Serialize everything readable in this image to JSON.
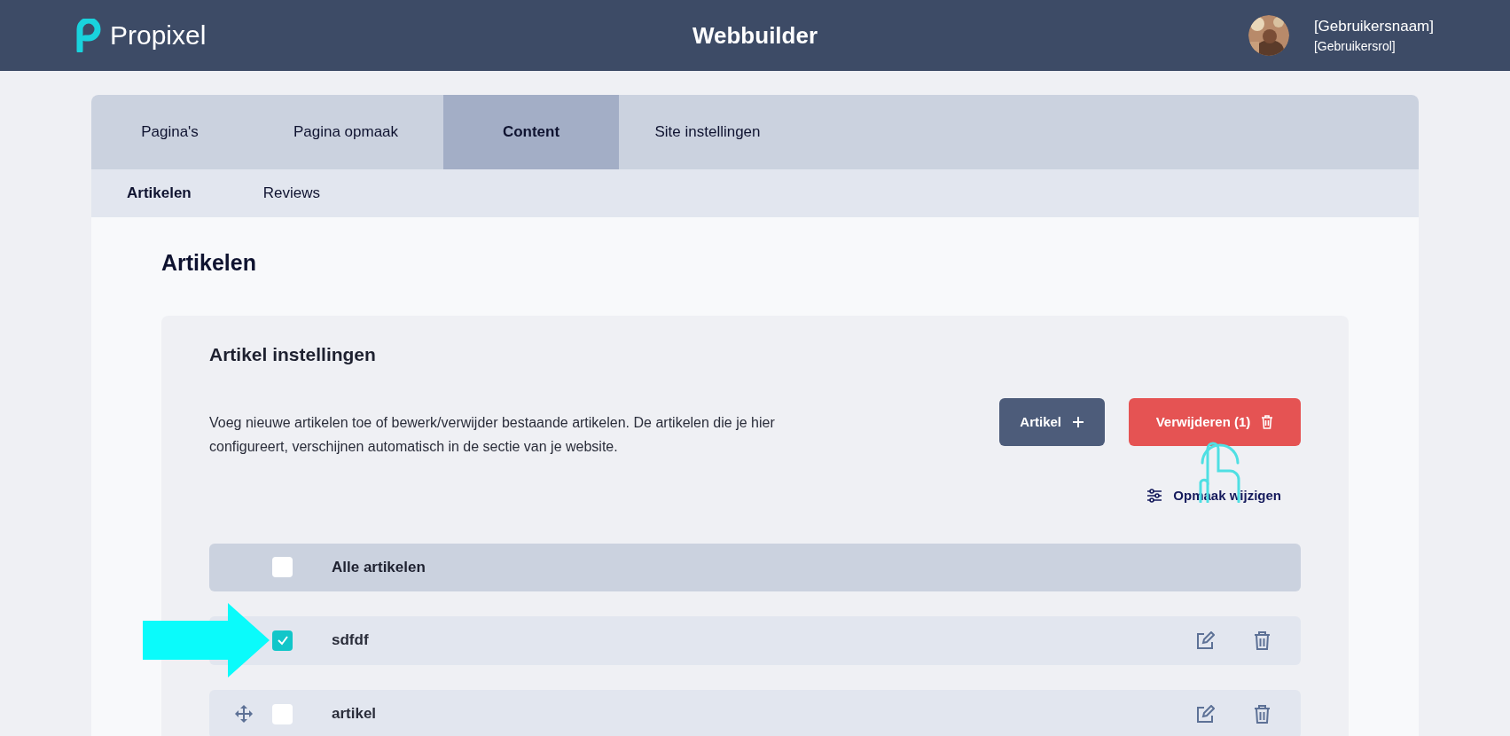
{
  "header": {
    "logo_text": "Propixel",
    "title": "Webbuilder",
    "user_name": "[Gebruikersnaam]",
    "user_role": "[Gebruikersrol]"
  },
  "tabs": [
    {
      "label": "Pagina's",
      "selected": false
    },
    {
      "label": "Pagina opmaak",
      "selected": false
    },
    {
      "label": "Content",
      "selected": true
    },
    {
      "label": "Site instellingen",
      "selected": false
    }
  ],
  "subtabs": [
    {
      "label": "Artikelen",
      "selected": true
    },
    {
      "label": "Reviews",
      "selected": false
    }
  ],
  "heading": "Artikelen",
  "panel": {
    "title": "Artikel instellingen",
    "description": "Voeg nieuwe artikelen toe of bewerk/verwijder bestaande artikelen. De artikelen die je hier configureert, verschijnen automatisch in de sectie van je website.",
    "add_button": "Artikel",
    "delete_button": "Verwijderen (1)",
    "layout_link": "Opmaak wijzigen"
  },
  "table": {
    "select_all": {
      "label": "Alle artikelen",
      "checked": false
    },
    "rows": [
      {
        "title": "sdfdf",
        "checked": true,
        "handle": false
      },
      {
        "title": "artikel",
        "checked": false,
        "handle": true
      }
    ]
  },
  "annotations": {
    "arrow": true,
    "hand_cursor": true
  }
}
